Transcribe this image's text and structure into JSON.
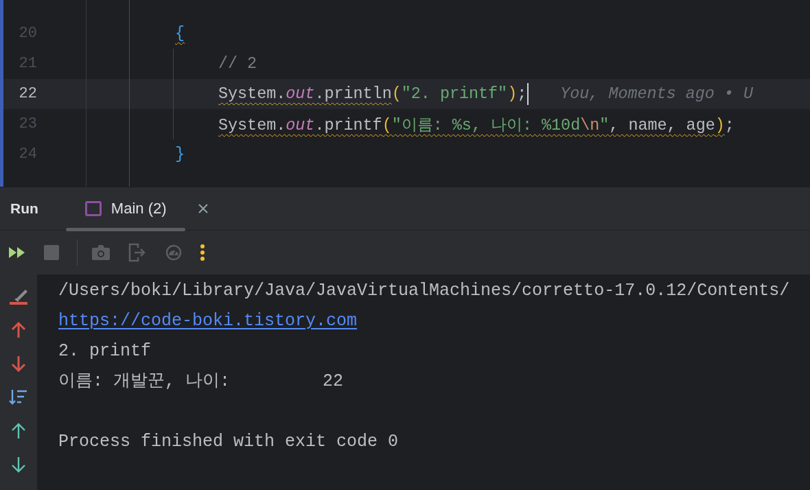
{
  "editor": {
    "lines": [
      {
        "number": "20",
        "current": false,
        "tokens": [
          {
            "text": "{",
            "kind": "brace",
            "warn": true
          }
        ],
        "children": [
          {
            "number": "21",
            "current": false,
            "tokens": [
              {
                "text": "// 2",
                "kind": "comment",
                "warn": false
              }
            ]
          },
          {
            "number": "22",
            "current": true,
            "blame": "You, Moments ago • U",
            "tokens": [
              {
                "text": "System.",
                "kind": "plain",
                "warn": true
              },
              {
                "text": "out",
                "kind": "field",
                "warn": true
              },
              {
                "text": ".println",
                "kind": "plain",
                "warn": true
              },
              {
                "text": "(",
                "kind": "paren",
                "warn": false
              },
              {
                "text": "\"2. printf\"",
                "kind": "string",
                "warn": false
              },
              {
                "text": ")",
                "kind": "paren",
                "warn": false
              },
              {
                "text": ";",
                "kind": "plain",
                "warn": false
              }
            ]
          },
          {
            "number": "23",
            "current": false,
            "tokens": [
              {
                "text": "System.",
                "kind": "plain",
                "warn": true
              },
              {
                "text": "out",
                "kind": "field",
                "warn": true
              },
              {
                "text": ".printf",
                "kind": "plain",
                "warn": true
              },
              {
                "text": "(",
                "kind": "paren",
                "warn": true
              },
              {
                "text": "\"이름: %s, 나이: %10d",
                "kind": "string",
                "warn": true
              },
              {
                "text": "\\n",
                "kind": "escape",
                "warn": true
              },
              {
                "text": "\"",
                "kind": "string",
                "warn": true
              },
              {
                "text": ", name, age",
                "kind": "plain",
                "warn": true
              },
              {
                "text": ")",
                "kind": "paren",
                "warn": true
              },
              {
                "text": ";",
                "kind": "plain",
                "warn": false
              }
            ]
          }
        ]
      },
      {
        "number": "24",
        "current": false,
        "tokens": [
          {
            "text": "}",
            "kind": "brace",
            "warn": false
          }
        ]
      }
    ]
  },
  "run_panel": {
    "title": "Run",
    "tabs": [
      {
        "label": "Main (2)",
        "selected": true
      }
    ],
    "console": [
      {
        "kind": "text",
        "text": "/Users/boki/Library/Java/JavaVirtualMachines/corretto-17.0.12/Contents/"
      },
      {
        "kind": "link",
        "text": "https://code-boki.tistory.com"
      },
      {
        "kind": "text",
        "text": "2. printf"
      },
      {
        "kind": "text",
        "text": "이름: 개발꾼, 나이:         22"
      },
      {
        "kind": "summary",
        "text": "Process finished with exit code 0"
      }
    ]
  }
}
